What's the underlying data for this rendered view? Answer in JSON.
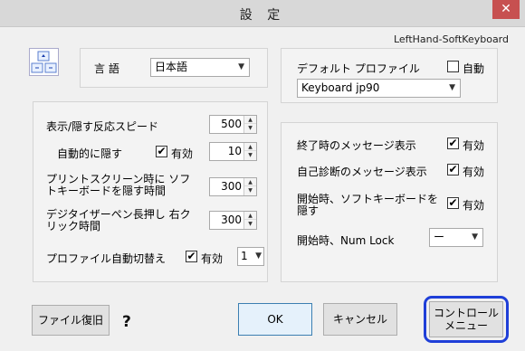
{
  "window": {
    "title": "設 定",
    "close_glyph": "✕"
  },
  "app_name": "LeftHand-SoftKeyboard",
  "language": {
    "label": "言 語",
    "value": "日本語"
  },
  "profile": {
    "label": "デフォルト プロファイル",
    "auto_label": "自動",
    "auto_checked": false,
    "value": "Keyboard jp90"
  },
  "left_settings": {
    "speed_label": "表示/隠す反応スピード",
    "speed_value": "500",
    "autohide_label": "自動的に隠す",
    "autohide_enabled_label": "有効",
    "autohide_checked": true,
    "autohide_value": "10",
    "printscreen_label": "プリントスクリーン時に ソフトキーボードを隠す時間",
    "printscreen_value": "300",
    "pen_label": "デジタイザーペン長押し 右クリック時間",
    "pen_value": "300",
    "profile_switch_label": "プロファイル自動切替え",
    "profile_switch_enabled_label": "有効",
    "profile_switch_checked": true,
    "profile_switch_value": "1"
  },
  "right_settings": {
    "exit_msg_label": "終了時のメッセージ表示",
    "exit_msg_enabled": "有効",
    "exit_msg_checked": true,
    "selfdiag_label": "自己診断のメッセージ表示",
    "selfdiag_enabled": "有効",
    "selfdiag_checked": true,
    "hide_on_start_label": "開始時、ソフトキーボードを 隠す",
    "hide_on_start_enabled": "有効",
    "hide_on_start_checked": true,
    "numlock_label": "開始時、Num Lock",
    "numlock_value": "ー"
  },
  "buttons": {
    "restore_file": "ファイル復旧",
    "help": "?",
    "ok": "OK",
    "cancel": "キャンセル",
    "control_menu_line1": "コントロール",
    "control_menu_line2": "メニュー"
  },
  "colors": {
    "highlight": "#1f3fd8",
    "close_button": "#c75050"
  },
  "icons": {
    "layout": "keyboard-layout-icon",
    "help": "question-mark-icon",
    "dropdown": "chevron-down-icon",
    "check": "✔"
  }
}
